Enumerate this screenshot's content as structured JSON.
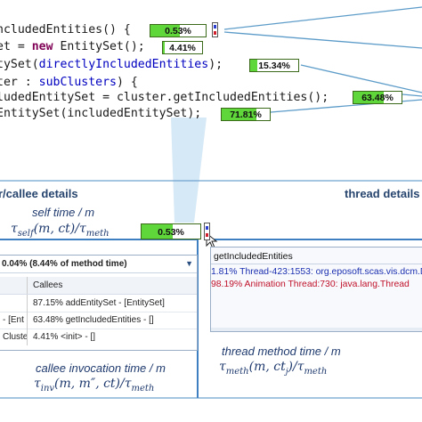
{
  "code": {
    "line1": "ncludedEntities() {",
    "line2a": "et = ",
    "line2kw": "new",
    "line2b": " EntitySet();",
    "line3a": "tySet(",
    "line3id": "directlyIncludedEntities",
    "line3b": ");",
    "line4a": "ter : ",
    "line4id": "subClusters",
    "line4b": ") {",
    "line5": "ludedEntitySet = cluster.getIncludedEntities();",
    "line6": "EntitySet(includedEntitySet);"
  },
  "metrics": {
    "m1": {
      "label": "0.53%",
      "fraction": 0.53
    },
    "m2": {
      "label": "4.41%",
      "fraction": 0.0441
    },
    "m3": {
      "label": "15.34%",
      "fraction": 0.1534
    },
    "m4": {
      "label": "63.48%",
      "fraction": 0.6348
    },
    "m5": {
      "label": "71.81%",
      "fraction": 0.7181
    },
    "m6": {
      "label": "0.53%",
      "fraction": 0.53
    }
  },
  "sections": {
    "left": "r/callee details",
    "right": "thread details"
  },
  "labels": {
    "self_time": "self time / m",
    "self_formula": "τself(m, ct)/τmeth",
    "callee_time": "callee invocation time / m",
    "callee_formula": "τinv(m, m″, ct)/τmeth",
    "thread_time": "thread method time / m",
    "thread_formula": "τmeth(m, ctj)/τmeth"
  },
  "callee_panel": {
    "header": "0.04% (8.44% of method time)",
    "column": "Callees",
    "rows": [
      {
        "left": "",
        "value": "87.15% addEntitySet - [EntitySet]"
      },
      {
        "left": "- [Ent",
        "value": "63.48% getIncludedEntities - []"
      },
      {
        "left": "Cluste",
        "value": "4.41% <init> - []"
      }
    ]
  },
  "thread_panel": {
    "title": "getIncludedEntities",
    "lines": [
      {
        "text": "1.81% Thread-423:1553: org.eposoft.scas.vis.dcm.Dua",
        "color": "#1b2fb0"
      },
      {
        "text": "98.19% Animation Thread:730: java.lang.Thread",
        "color": "#c0112a"
      }
    ]
  }
}
